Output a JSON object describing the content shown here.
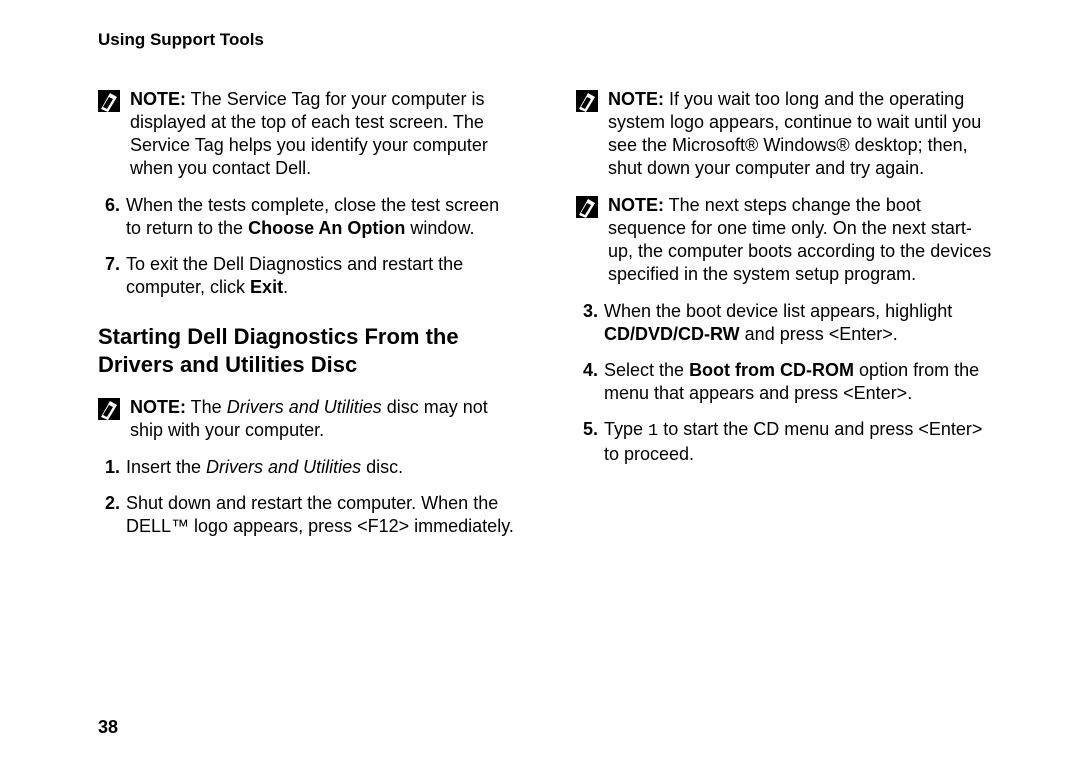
{
  "header": "Using Support Tools",
  "page_number": "38",
  "left": {
    "note1_label": "NOTE:",
    "note1_text": " The Service Tag for your computer is displayed at the top of each test screen. The Service Tag helps you identify your computer when you contact Dell.",
    "step6_num": "6.",
    "step6_pre": "When the tests complete, close the test screen to return to the ",
    "step6_bold": "Choose An Option",
    "step6_post": " window.",
    "step7_num": "7.",
    "step7_pre": "To exit the Dell Diagnostics and restart the computer, click ",
    "step7_bold": "Exit",
    "step7_post": ".",
    "heading": "Starting Dell Diagnostics From the Drivers and Utilities Disc",
    "note2_label": "NOTE:",
    "note2_pre": " The ",
    "note2_italic": "Drivers and Utilities",
    "note2_post": " disc may not ship with your computer.",
    "step1_num": "1.",
    "step1_pre": "Insert the ",
    "step1_italic": "Drivers and Utilities",
    "step1_post": " disc.",
    "step2_num": "2.",
    "step2_text": "Shut down and restart the computer. When the DELL™ logo appears, press <F12> immediately."
  },
  "right": {
    "note1_label": "NOTE:",
    "note1_text": " If you wait too long and the operating system logo appears, continue to wait until you see the Microsoft® Windows® desktop; then, shut down your computer and try again.",
    "note2_label": "NOTE:",
    "note2_text": " The next steps change the boot sequence for one time only. On the next start-up, the computer boots according to the devices specified in the system setup program.",
    "step3_num": "3.",
    "step3_pre": "When the boot device list appears, highlight ",
    "step3_bold": "CD/DVD/CD-RW",
    "step3_post": " and press <Enter>.",
    "step4_num": "4.",
    "step4_pre": "Select the ",
    "step4_bold": "Boot from CD-ROM",
    "step4_post": " option from the menu that appears and press <Enter>.",
    "step5_num": "5.",
    "step5_pre": "Type ",
    "step5_mono": "1",
    "step5_post": " to start the CD menu and press <Enter> to proceed."
  }
}
